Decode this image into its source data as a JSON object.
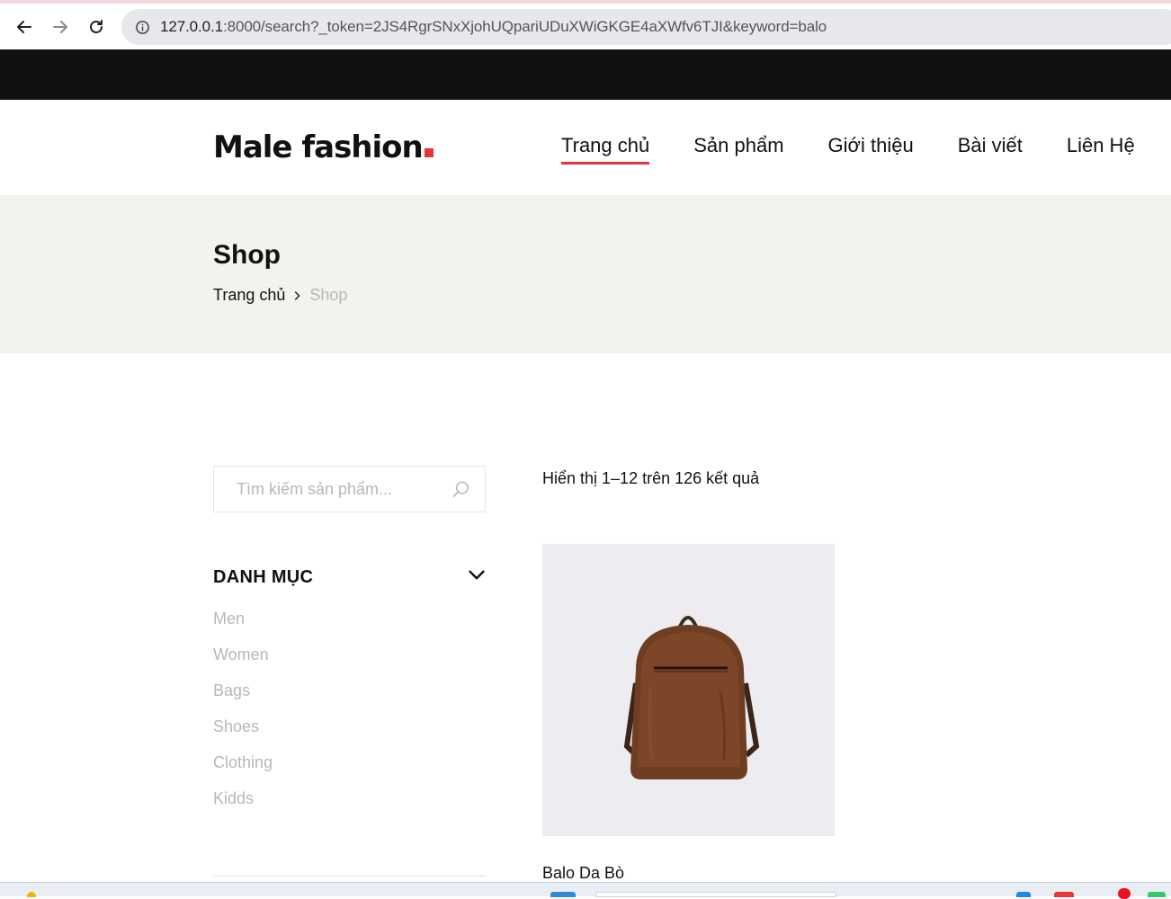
{
  "browser": {
    "url_host": "127.0.0.1",
    "url_rest": ":8000/search?_token=2JS4RgrSNxXjohUQpariUDuXWiGKGE4aXWfv6TJI&keyword=balo",
    "back_icon": "arrow-left-icon",
    "forward_icon": "arrow-right-icon",
    "reload_icon": "reload-icon",
    "info_icon": "info-circle-icon"
  },
  "header": {
    "logo_text": "Male fashion",
    "logo_accent_color": "#e53637",
    "nav": [
      {
        "label": "Trang chủ",
        "active": true
      },
      {
        "label": "Sản phẩm",
        "active": false
      },
      {
        "label": "Giới thiệu",
        "active": false
      },
      {
        "label": "Bài viết",
        "active": false
      },
      {
        "label": "Liên Hệ",
        "active": false
      }
    ]
  },
  "breadcrumb": {
    "title": "Shop",
    "home": "Trang chủ",
    "current": "Shop"
  },
  "sidebar": {
    "search_placeholder": "Tìm kiếm sản phẩm...",
    "categories_title": "DANH MỤC",
    "categories": [
      "Men",
      "Women",
      "Bags",
      "Shoes",
      "Clothing",
      "Kidds"
    ]
  },
  "results": {
    "count_text": "Hiển thị 1–12 trên 126 kết quả"
  },
  "products": [
    {
      "name": "Balo Da Bò",
      "image": "brown-leather-backpack"
    }
  ],
  "colors": {
    "accent": "#e53637",
    "dark_bar": "#111111",
    "breadcrumb_bg": "#f3f2ee",
    "muted_text": "#b7b7b7"
  }
}
